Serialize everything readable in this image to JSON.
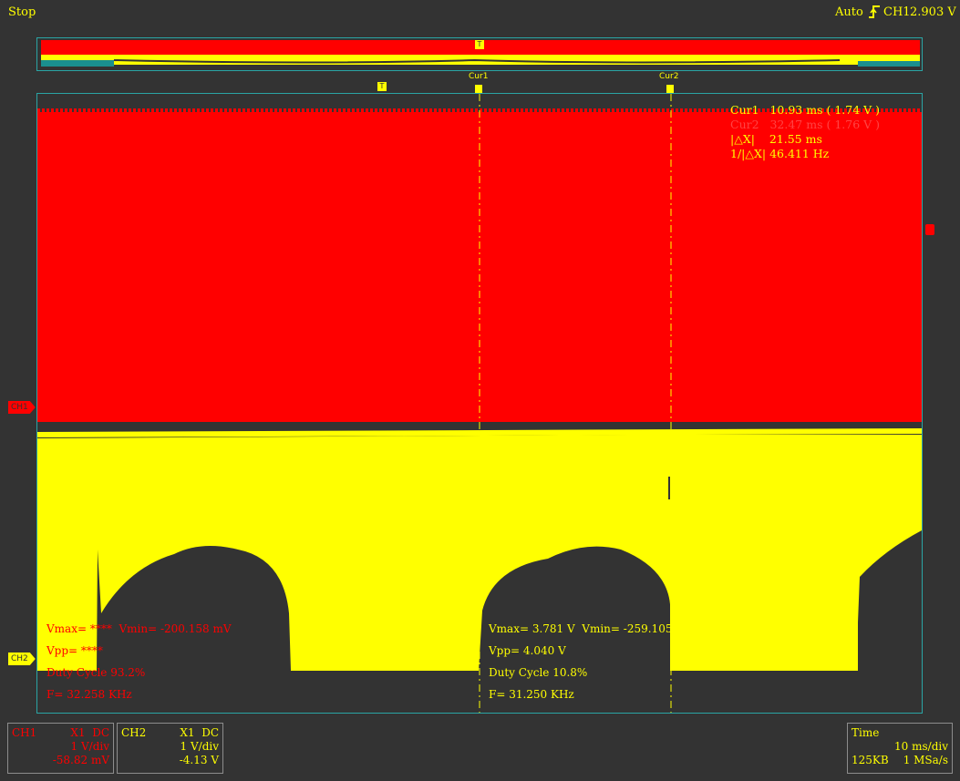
{
  "status": {
    "run_state": "Stop",
    "trigger_mode": "Auto",
    "trigger_channel": "CH1",
    "trigger_level": "2.903 V"
  },
  "markers": {
    "trigger": "T",
    "cursor1": "Cur1",
    "cursor2": "Cur2",
    "right_edge": ""
  },
  "channel_tags": {
    "ch1": "CH1",
    "ch2": "CH2"
  },
  "cursor_readout": {
    "cur1": "Cur1   10.93 ms ( 1.74 V )",
    "cur2": "Cur2   32.47 ms ( 1.76 V )",
    "delta_x": "|△X|    21.55 ms",
    "inv_delta_x": "1/|△X| 46.411 Hz"
  },
  "measurements_ch1": {
    "vmax_vmin": "Vmax= ****  Vmin= -200.158 mV",
    "vpp": "Vpp= ****",
    "duty": "Duty Cycle 93.2%",
    "freq": "F= 32.258 KHz"
  },
  "measurements_ch2": {
    "vmax_vmin": "Vmax= 3.781 V  Vmin= -259.105",
    "vpp": "Vpp= 4.040 V",
    "duty": "Duty Cycle 10.8%",
    "freq": "F= 31.250 KHz"
  },
  "ch1_info": {
    "name": "CH1",
    "probe_coupling": "X1  DC",
    "scale": "1 V/div",
    "offset": "-58.82 mV"
  },
  "ch2_info": {
    "name": "CH2",
    "probe_coupling": "X1  DC",
    "scale": "1 V/div",
    "offset": "-4.13 V"
  },
  "time_info": {
    "label": "Time",
    "timebase": "10 ms/div",
    "memory": "125KB",
    "sample_rate": "1 MSa/s"
  },
  "colors": {
    "ch1": "#ff0000",
    "ch2": "#ffff00",
    "background": "#333333",
    "frame": "#2aa5a5"
  }
}
